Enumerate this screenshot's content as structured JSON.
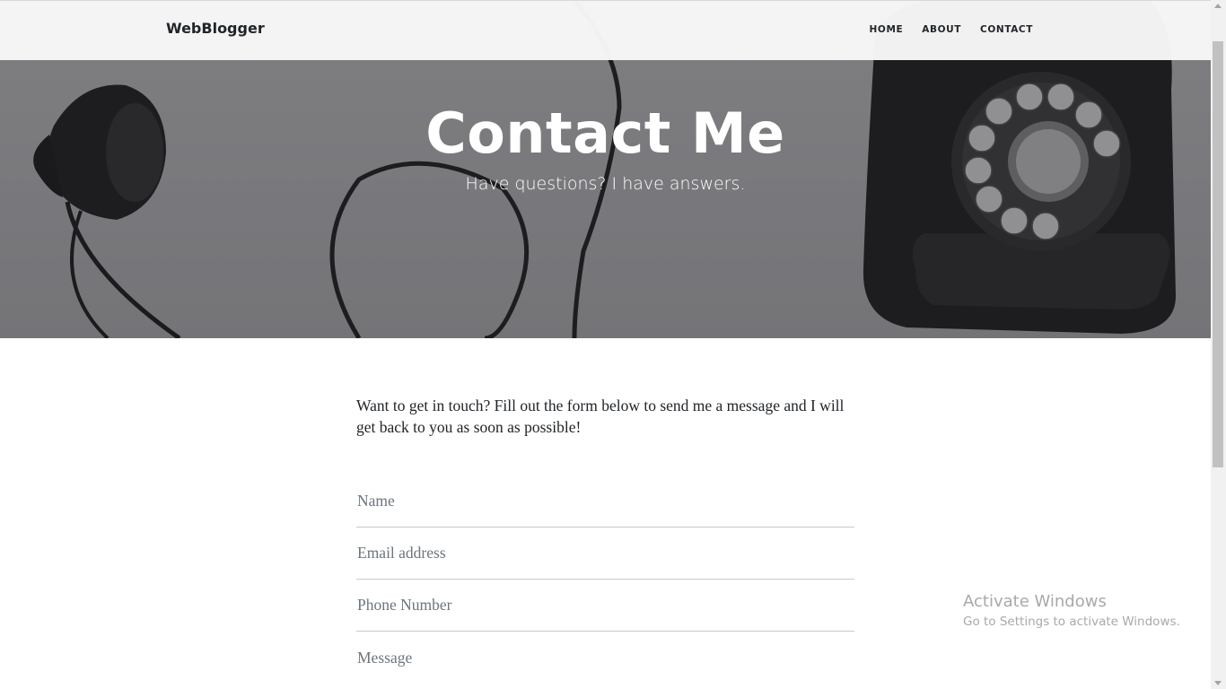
{
  "navbar": {
    "brand": "WebBlogger",
    "links": [
      "HOME",
      "ABOUT",
      "CONTACT"
    ]
  },
  "hero": {
    "title": "Contact Me",
    "subtitle": "Have questions? I have answers."
  },
  "main": {
    "intro": "Want to get in touch? Fill out the form below to send me a message and I will get back to you as soon as possible!",
    "form": {
      "name_placeholder": "Name",
      "email_placeholder": "Email address",
      "phone_placeholder": "Phone Number",
      "message_placeholder": "Message"
    }
  },
  "watermark": {
    "title": "Activate Windows",
    "subtitle": "Go to Settings to activate Windows."
  }
}
